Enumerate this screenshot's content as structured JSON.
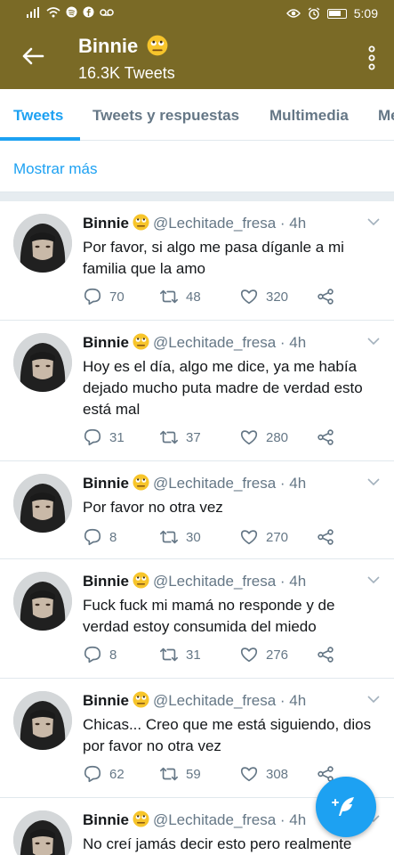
{
  "status_bar": {
    "time": "5:09"
  },
  "header": {
    "title": "Binnie",
    "tweet_count": "16.3K Tweets"
  },
  "tabs": [
    {
      "label": "Tweets",
      "active": true
    },
    {
      "label": "Tweets y respuestas",
      "active": false
    },
    {
      "label": "Multimedia",
      "active": false
    },
    {
      "label": "Me",
      "active": false
    }
  ],
  "show_more": "Mostrar más",
  "colors": {
    "header": "#7a6a26",
    "accent": "#1da1f2",
    "muted": "#657786"
  },
  "tweets": [
    {
      "name": "Binnie",
      "handle": "@Lechitade_fresa",
      "time": "· 4h",
      "text": "Por favor, si algo me pasa díganle a mi familia que la amo",
      "replies": "70",
      "retweets": "48",
      "likes": "320"
    },
    {
      "name": "Binnie",
      "handle": "@Lechitade_fresa",
      "time": "· 4h",
      "text": "Hoy es el día, algo me dice, ya me había dejado mucho puta madre de verdad esto está mal",
      "replies": "31",
      "retweets": "37",
      "likes": "280"
    },
    {
      "name": "Binnie",
      "handle": "@Lechitade_fresa",
      "time": "· 4h",
      "text": "Por favor no otra vez",
      "replies": "8",
      "retweets": "30",
      "likes": "270"
    },
    {
      "name": "Binnie",
      "handle": "@Lechitade_fresa",
      "time": "· 4h",
      "text": "Fuck fuck mi mamá no responde y de verdad estoy consumida del miedo",
      "replies": "8",
      "retweets": "31",
      "likes": "276"
    },
    {
      "name": "Binnie",
      "handle": "@Lechitade_fresa",
      "time": "· 4h",
      "text": "Chicas... Creo que me está siguiendo, dios por favor no otra vez",
      "replies": "62",
      "retweets": "59",
      "likes": "308"
    },
    {
      "name": "Binnie",
      "handle": "@Lechitade_fresa",
      "time": "· 4h",
      "text": "No creí jamás decir esto pero realmente",
      "replies": "",
      "retweets": "",
      "likes": ""
    }
  ]
}
